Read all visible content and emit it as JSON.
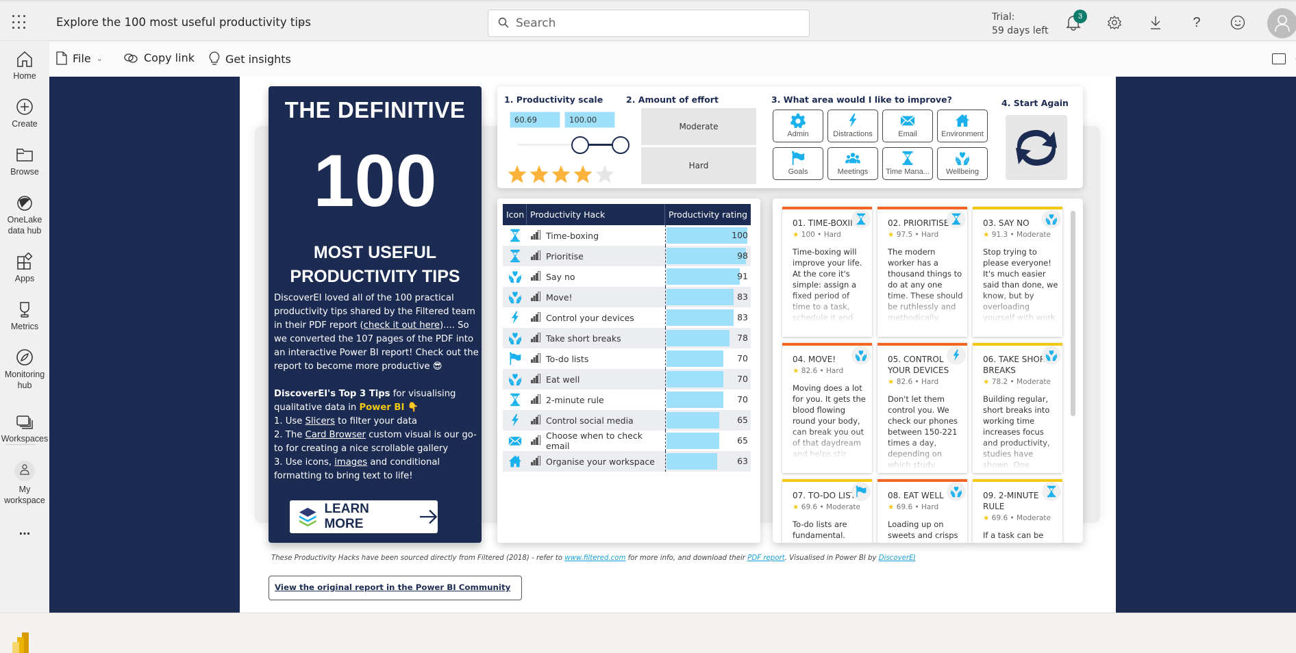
{
  "header": {
    "title": "Explore the 100 most useful productivity tips",
    "search_placeholder": "Search",
    "trial_line1": "Trial:",
    "trial_line2": "59 days left",
    "notification_count": "3"
  },
  "toolbar": {
    "file_label": "File",
    "copy_link_label": "Copy link",
    "get_insights_label": "Get insights"
  },
  "sidebar": {
    "items": [
      {
        "label": "Home",
        "icon": "home-icon"
      },
      {
        "label": "Create",
        "icon": "plus-circle-icon"
      },
      {
        "label": "Browse",
        "icon": "folder-icon"
      },
      {
        "label": "OneLake data hub",
        "icon": "onelake-icon"
      },
      {
        "label": "Apps",
        "icon": "apps-icon"
      },
      {
        "label": "Metrics",
        "icon": "trophy-icon"
      },
      {
        "label": "Monitoring hub",
        "icon": "monitoring-icon"
      },
      {
        "label": "Workspaces",
        "icon": "workspaces-icon"
      },
      {
        "label": "My workspace",
        "icon": "person-icon"
      },
      {
        "label": "...",
        "icon": "more-icon"
      }
    ],
    "footer_label": "Power BI"
  },
  "hero": {
    "heading": "THE DEFINITIVE",
    "number": "100",
    "subheading_line1": "MOST USEFUL",
    "subheading_line2": "PRODUCTIVITY TIPS",
    "para1_a": "DiscoverEI loved all of the 100 practical productivity tips shared by the Filtered team in their PDF report (",
    "para1_link": "check it out here",
    "para1_b": ").... So we converted the 107 pages of the PDF into an interactive Power BI report! Check out the report to become more productive 😎",
    "tips_bold": "DiscoverEI's Top 3 Tips",
    "tips_intro": " for visualising qualitative data in ",
    "tips_brand": "Power BI",
    "tips_emoji": "👇",
    "tip1_a": "1. Use ",
    "tip1_link": "Slicers",
    "tip1_b": " to filter your data",
    "tip2_a": "2. The ",
    "tip2_link": "Card Browser",
    "tip2_b": " custom visual is our go-to for creating a nice scrollable gallery",
    "tip3_a": "3. Use icons, ",
    "tip3_link": "images",
    "tip3_b": " and conditional formatting to bring text to life!",
    "learn_more_label": "LEARN MORE"
  },
  "filters": {
    "productivity_title": "1. Productivity scale",
    "range_min": "60.69",
    "range_max": "100.00",
    "scale_min": 0,
    "scale_max": 100,
    "stars_filled": 4,
    "stars_total": 5,
    "effort_title": "2. Amount of effort",
    "effort_options": [
      "Moderate",
      "Hard"
    ],
    "area_title": "3. What area would I like to improve?",
    "areas": [
      {
        "label": "Admin",
        "icon": "gear-icon"
      },
      {
        "label": "Distractions",
        "icon": "lightning-icon"
      },
      {
        "label": "Email",
        "icon": "envelope-icon"
      },
      {
        "label": "Environment",
        "icon": "house-icon"
      },
      {
        "label": "Goals",
        "icon": "flag-icon"
      },
      {
        "label": "Meetings",
        "icon": "people-icon"
      },
      {
        "label": "Time Mana...",
        "icon": "hourglass-icon"
      },
      {
        "label": "Wellbeing",
        "icon": "heart-hands-icon"
      }
    ],
    "start_again_title": "4. Start Again"
  },
  "table": {
    "headers": [
      "Icon",
      "Productivity Hack",
      "Productivity rating"
    ],
    "max_rating": 100,
    "rows": [
      {
        "icon": "hourglass-icon",
        "hack": "Time-boxing",
        "rating": 100
      },
      {
        "icon": "hourglass-icon",
        "hack": "Prioritise",
        "rating": 98
      },
      {
        "icon": "heart-hands-icon",
        "hack": "Say no",
        "rating": 91
      },
      {
        "icon": "heart-hands-icon",
        "hack": "Move!",
        "rating": 83
      },
      {
        "icon": "lightning-icon",
        "hack": "Control your devices",
        "rating": 83
      },
      {
        "icon": "heart-hands-icon",
        "hack": "Take short breaks",
        "rating": 78
      },
      {
        "icon": "flag-icon",
        "hack": "To-do lists",
        "rating": 70
      },
      {
        "icon": "heart-hands-icon",
        "hack": "Eat well",
        "rating": 70
      },
      {
        "icon": "hourglass-icon",
        "hack": "2-minute rule",
        "rating": 70
      },
      {
        "icon": "lightning-icon",
        "hack": "Control social media",
        "rating": 65
      },
      {
        "icon": "envelope-icon",
        "hack": "Choose when to check email",
        "rating": 65
      },
      {
        "icon": "house-icon",
        "hack": "Organise your workspace",
        "rating": 63
      }
    ]
  },
  "cards": [
    {
      "title": "01. TIME-BOXING",
      "score": "100",
      "effort": "Hard",
      "icon": "hourglass-icon",
      "body": "Time-boxing will improve your life. At the core it's simple: assign a fixed period of time to a task, schedule it and"
    },
    {
      "title": "02. PRIORITISE",
      "score": "97.5",
      "effort": "Hard",
      "icon": "hourglass-icon",
      "body": "The modern worker has a thousand things to do at any one time. These should be ruthlessly and methodically"
    },
    {
      "title": "03. SAY NO",
      "score": "91.3",
      "effort": "Moderate",
      "icon": "heart-hands-icon",
      "body": "Stop trying to please everyone! It's much easier said than done, we know, but by overloading yourself with work, not only do"
    },
    {
      "title": "04. MOVE!",
      "score": "82.6",
      "effort": "Hard",
      "icon": "heart-hands-icon",
      "body": "Moving does a lot for you. It gets the blood flowing round your body, can break you out of that daydream and helps stir creative thoughts."
    },
    {
      "title": "05. CONTROL YOUR DEVICES",
      "score": "82.6",
      "effort": "Hard",
      "icon": "lightning-icon",
      "body": "Don't let them control you. We check our phones between 150-221 times a day, depending on which study"
    },
    {
      "title": "06. TAKE SHORT BREAKS",
      "score": "78.2",
      "effort": "Moderate",
      "icon": "heart-hands-icon",
      "body": "Building regular, short breaks into working time increases focus and productivity, studies have shown. One"
    },
    {
      "title": "07. TO-DO LISTS",
      "score": "69.6",
      "effort": "Moderate",
      "icon": "flag-icon",
      "body": "To-do lists are fundamental."
    },
    {
      "title": "08. EAT WELL",
      "score": "69.6",
      "effort": "Hard",
      "icon": "heart-hands-icon",
      "body": "Loading up on sweets and crisps"
    },
    {
      "title": "09. 2-MINUTE RULE",
      "score": "69.6",
      "effort": "Moderate",
      "icon": "hourglass-icon",
      "body": "If a task can be"
    }
  ],
  "colors": {
    "navy": "#1c2b52",
    "accent_blue": "#1ab0ec",
    "bar_blue": "#9ee0f9",
    "hard": "#f26522",
    "moderate": "#f2c811",
    "star": "#fbb33b"
  },
  "footer": {
    "note_a": "These Productivity Hacks have been sourced directly from Filtered (2018) - refer to ",
    "note_link1": "www.filtered.com",
    "note_b": " for more info, and download their ",
    "note_link2": "PDF report",
    "note_c": ". Visualised in Power BI by ",
    "note_link3": "DiscoverEI",
    "community_button": "View the original report in the Power BI Community"
  }
}
